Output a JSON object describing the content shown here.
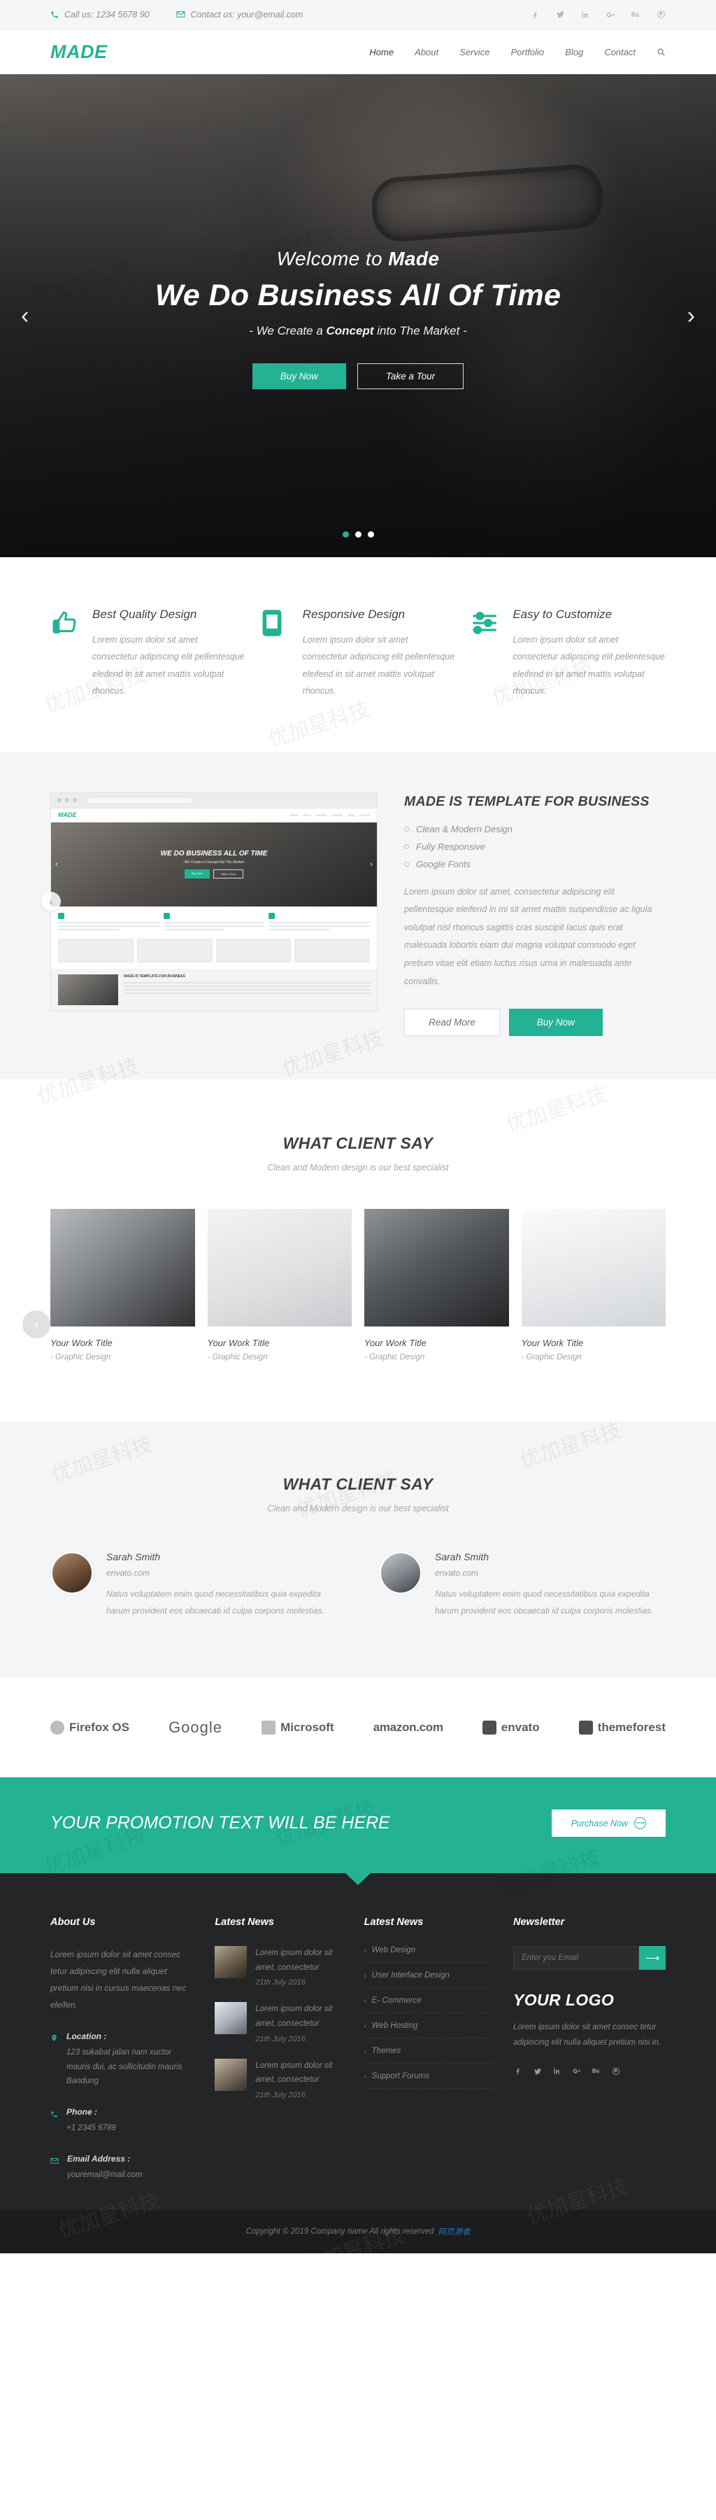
{
  "topbar": {
    "phone_icon": "phone-icon",
    "phone": "Call us: 1234 5678 90",
    "mail_icon": "envelope-icon",
    "email": "Contact us: your@email.com",
    "socials": [
      "facebook-icon",
      "twitter-icon",
      "linkedin-icon",
      "googleplus-icon",
      "behance-icon",
      "pinterest-icon"
    ]
  },
  "header": {
    "logo": "MADE",
    "nav": [
      {
        "label": "Home",
        "active": true
      },
      {
        "label": "About",
        "active": false
      },
      {
        "label": "Service",
        "active": false
      },
      {
        "label": "Portfolio",
        "active": false
      },
      {
        "label": "Blog",
        "active": false
      },
      {
        "label": "Contact",
        "active": false
      }
    ],
    "search_icon": "search-icon"
  },
  "hero": {
    "welcome_prefix": "Welcome to ",
    "welcome_brand": "Made",
    "title": "We Do Business All Of Time",
    "sub_before": "- We Create a ",
    "sub_bold": "Concept",
    "sub_after": " into The Market -",
    "btn_primary": "Buy Now",
    "btn_secondary": "Take a Tour",
    "prev_icon": "chevron-left-icon",
    "next_icon": "chevron-right-icon",
    "dots": 3,
    "active_dot": 0
  },
  "features": [
    {
      "icon": "thumbs-up-icon",
      "title": "Best Quality Design",
      "text": "Lorem ipsum dolor sit amet consectetur adipiscing elit pellentesque eleifend in sit amet mattis volutpat rhoncus."
    },
    {
      "icon": "tablet-icon",
      "title": "Responsive Design",
      "text": "Lorem ipsum dolor sit amet consectetur adipiscing elit pellentesque eleifend in sit amet mattis volutpat rhoncus."
    },
    {
      "icon": "sliders-icon",
      "title": "Easy to Customize",
      "text": "Lorem ipsum dolor sit amet consectetur adipiscing elit pellentesque eleifend in sit amet mattis volutpat rhoncus."
    }
  ],
  "about": {
    "heading": "MADE IS TEMPLATE FOR BUSINESS",
    "list": [
      "Clean & Modern Design",
      "Fully Responsive",
      "Google Fonts"
    ],
    "text": "Lorem ipsum dolor sit amet, consectetur adipiscing elit pellentesque eleifend in mi sit amet mattis suspendisse ac ligula volutpat nisl rhoncus sagittis cras suscipit lacus quis erat malesuada lobortis eiam dui magna volutpat commodo eget pretium vitae elit etiam luctus risus urna in malesuada ante convallis.",
    "btn_outline": "Read More",
    "btn_primary": "Buy Now",
    "preview": {
      "logo": "MADE",
      "nav": [
        "Home",
        "About",
        "Service",
        "Portfolio",
        "Blog",
        "Contact"
      ],
      "hero_title": "WE DO BUSINESS ALL OF TIME",
      "hero_sub": "- We Create a Concept into The Market -",
      "btn1": "Buy Now",
      "btn2": "Take a Tour",
      "footer_title": "MADE IS TEMPLATE FOR BUSINESS"
    },
    "slide_prev_icon": "chevron-left-icon"
  },
  "work": {
    "heading": "WHAT CLIENT SAY",
    "subheading": "Clean and Modern design is our best specialist",
    "prev_icon": "chevron-left-icon",
    "items": [
      {
        "title": "Your Work Title",
        "category": "- Graphic Design"
      },
      {
        "title": "Your Work Title",
        "category": "- Graphic Design"
      },
      {
        "title": "Your Work Title",
        "category": "- Graphic Design"
      },
      {
        "title": "Your Work Title",
        "category": "- Graphic Design"
      }
    ]
  },
  "testimonials": {
    "heading": "WHAT CLIENT SAY",
    "subheading": "Clean and Modern design is our best specialist",
    "items": [
      {
        "name": "Sarah Smith",
        "site": "envato.com",
        "text": "Natus voluptatem enim quod necessitatibus quia expedita harum provident eos obcaecati id culpa corporis molestias.",
        "quote_icon": "quote-icon"
      },
      {
        "name": "Sarah Smith",
        "site": "envato.com",
        "text": "Natus voluptatem enim quod necessitatibus quia expedita harum provident eos obcaecati id culpa corporis molestias.",
        "quote_icon": "quote-icon"
      }
    ]
  },
  "brands": [
    "Firefox OS",
    "Google",
    "Microsoft",
    "amazon.com",
    "envato",
    "themeforest"
  ],
  "promo": {
    "text": "YOUR PROMOTION TEXT WILL BE HERE",
    "button": "Purchase Now",
    "button_icon": "arrow-right-icon"
  },
  "footer": {
    "about": {
      "title": "About Us",
      "text": "Lorem ipsum dolor sit amet consec tetur adipiscing elit nulla aliquet pretium nisi in cursus maecenas nec eleifen.",
      "location_icon": "map-pin-icon",
      "location_title": "Location :",
      "location_value": "123 sukabat jalan nam xuctor mauris dui, ac sollicitudin mauris Bandung",
      "phone_icon": "phone-icon",
      "phone_title": "Phone :",
      "phone_value": "+1 2345 6789",
      "email_icon": "envelope-icon",
      "email_title": "Email Address :",
      "email_value": "youremail@mail.com"
    },
    "news": {
      "title": "Latest News",
      "items": [
        {
          "text": "Lorem ipsum dolor sit amet, consectetur",
          "date": "21th July 2016",
          "thumb": "camera-thumb"
        },
        {
          "text": "Lorem ipsum dolor sit amet, consectetur",
          "date": "21th July 2016",
          "thumb": "coffee-thumb"
        },
        {
          "text": "Lorem ipsum dolor sit amet, consectetur",
          "date": "21th July 2016",
          "thumb": "person-thumb"
        }
      ]
    },
    "links": {
      "title": "Latest News",
      "items": [
        "Web Design",
        "User Interface Design",
        "E- Commerce",
        "Web Hosting",
        "Themes",
        "Support Forums"
      ]
    },
    "newsletter": {
      "title": "Newsletter",
      "placeholder": "Enter you Email",
      "submit_icon": "arrow-right-icon",
      "logo": "YOUR LOGO",
      "logo_text": "Lorem ipsum dolor sit amet consec tetur adipiscing elit nulla aliquet pretium nisi in.",
      "socials": [
        "facebook-icon",
        "twitter-icon",
        "linkedin-icon",
        "googleplus-icon",
        "behance-icon",
        "pinterest-icon"
      ]
    }
  },
  "copyright": {
    "text": "Copyright © 2019 Company name All rights reserved",
    "credit": "网页源者"
  },
  "colors": {
    "accent": "#23b293",
    "dark": "#242527",
    "darker": "#1b1c1e",
    "light_bg": "#f4f5f6"
  }
}
